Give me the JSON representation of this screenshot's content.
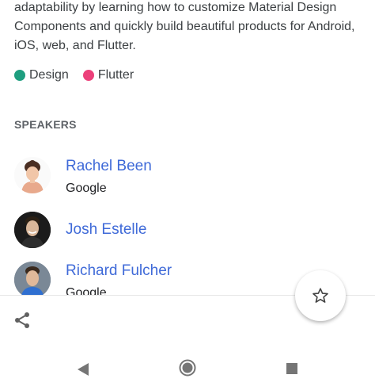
{
  "session": {
    "description": "adaptability by learning how to customize Material Design Components and quickly build beautiful products for Android, iOS, web, and Flutter.",
    "tags": [
      {
        "label": "Design",
        "color": "#1e9e7f"
      },
      {
        "label": "Flutter",
        "color": "#ec407a"
      }
    ]
  },
  "speakers_section": {
    "title": "SPEAKERS",
    "speakers": [
      {
        "name": "Rachel Been",
        "company": "Google"
      },
      {
        "name": "Josh Estelle",
        "company": ""
      },
      {
        "name": "Richard Fulcher",
        "company": "Google"
      }
    ]
  },
  "actions": {
    "fab_icon": "star-outline-icon",
    "share_icon": "share-icon"
  },
  "navigation_bar": {
    "back_icon": "back-triangle-icon",
    "home_icon": "home-circle-icon",
    "recents_icon": "recents-square-icon"
  },
  "colors": {
    "link": "#3f6ad8",
    "section_header": "#5f6368",
    "nav_icon": "#757575"
  }
}
